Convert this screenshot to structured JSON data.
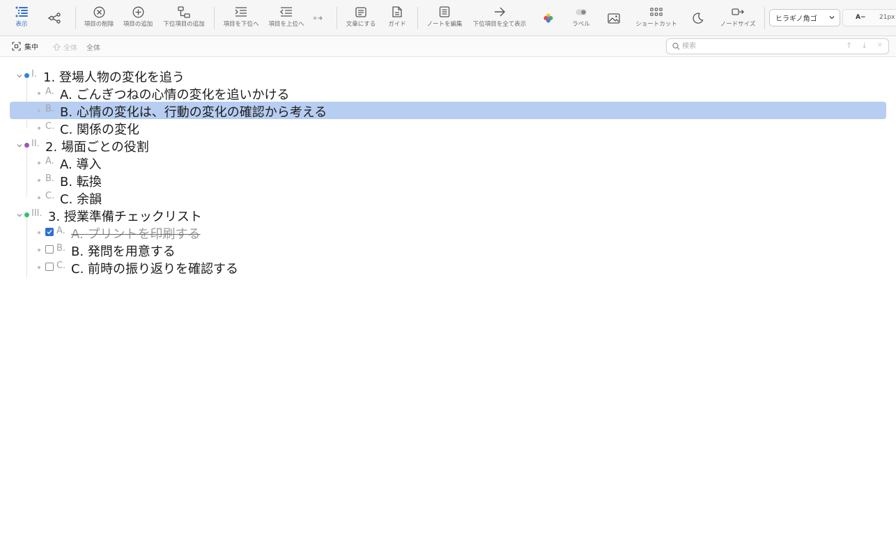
{
  "toolbar": {
    "view": "表示",
    "delete_item": "項目の削除",
    "add_item": "項目の追加",
    "add_child": "下位項目の追加",
    "move_down": "項目を下位へ",
    "move_up": "項目を上位へ",
    "to_text": "文章にする",
    "guide": "ガイド",
    "edit_note": "ノートを編集",
    "show_all_children": "下位項目を全て表示",
    "label": "ラベル",
    "shortcut": "ショートカット",
    "node_size": "ノードサイズ",
    "font_family": "ヒラギノ角ゴ",
    "font_decrease": "A−",
    "font_size": "21px"
  },
  "subbar": {
    "focus": "集中",
    "breadcrumb_home": "全体",
    "breadcrumb_current": "全体"
  },
  "search": {
    "placeholder": "検索",
    "value": "",
    "prev": "↑",
    "next": "↓",
    "clear": "×"
  },
  "outline": [
    {
      "num": "I.",
      "text": "1. 登場人物の変化を追う",
      "color": "#2f86d6"
    },
    {
      "num": "A.",
      "text": "A. ごんぎつねの心情の変化を追いかける"
    },
    {
      "num": "B.",
      "text": "B. 心情の変化は、行動の変化の確認から考える",
      "selected": true
    },
    {
      "num": "C.",
      "text": "C. 関係の変化"
    },
    {
      "num": "II.",
      "text": "2. 場面ごとの役割",
      "color": "#9b59b6"
    },
    {
      "num": "A.",
      "text": "A. 導入"
    },
    {
      "num": "B.",
      "text": "B. 転換"
    },
    {
      "num": "C.",
      "text": "C. 余韻"
    },
    {
      "num": "III.",
      "text": "3. 授業準備チェックリスト",
      "color": "#34c36b"
    },
    {
      "num": "A.",
      "text": "A. プリントを印刷する",
      "checked": true
    },
    {
      "num": "B.",
      "text": "B. 発問を用意する",
      "checked": false
    },
    {
      "num": "C.",
      "text": "C. 前時の振り返りを確認する",
      "checked": false
    }
  ]
}
